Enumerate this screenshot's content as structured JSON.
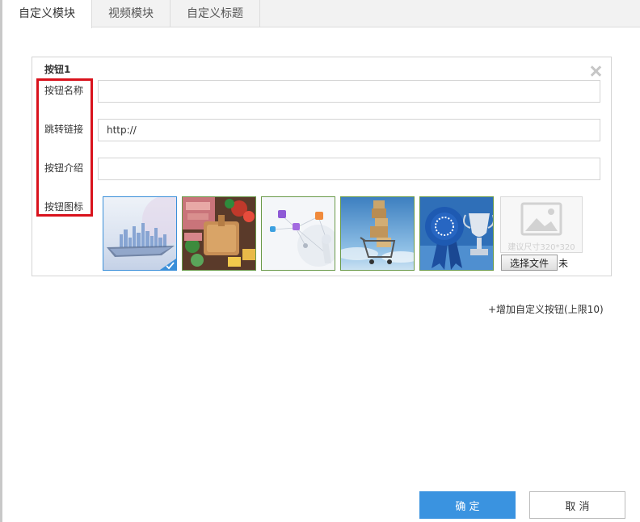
{
  "tabs": [
    {
      "label": "自定义模块",
      "active": true
    },
    {
      "label": "视频模块",
      "active": false
    },
    {
      "label": "自定义标题",
      "active": false
    }
  ],
  "panel": {
    "title": "按钮1",
    "fields": {
      "name_label": "按钮名称",
      "link_label": "跳转链接",
      "intro_label": "按钮介绍",
      "icon_label": "按钮图标"
    },
    "inputs": {
      "name_value": "",
      "link_value": "http://",
      "intro_value": ""
    },
    "thumbnails": [
      {
        "icon": "city-skyline-image",
        "selected": true
      },
      {
        "icon": "food-platter-image",
        "selected": false
      },
      {
        "icon": "network-diagram-image",
        "selected": false
      },
      {
        "icon": "shopping-cart-boxes-image",
        "selected": false
      },
      {
        "icon": "award-trophy-image",
        "selected": false
      }
    ],
    "upload": {
      "hint": "建议尺寸320*320",
      "button_label": "选择文件",
      "status_text": "未"
    }
  },
  "add_button_label": "+增加自定义按钮(上限10)",
  "footer": {
    "confirm_label": "确 定",
    "cancel_label": "取 消"
  },
  "colors": {
    "accent": "#3a93e0",
    "highlight_border": "#d9121c",
    "selected_border": "#3a8fd9"
  }
}
